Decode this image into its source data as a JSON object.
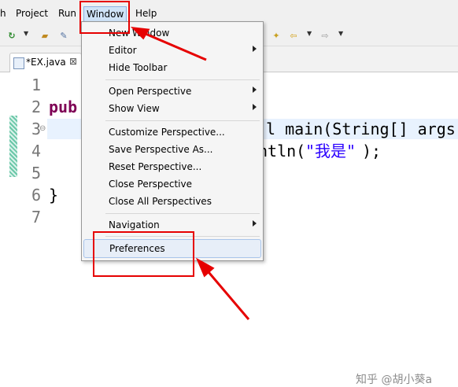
{
  "menubar": {
    "items": [
      "h",
      "Project",
      "Run",
      "Window",
      "Help"
    ],
    "active": "Window"
  },
  "editor_tab": {
    "title": "*EX.java",
    "close_glyph": "⊠"
  },
  "editor": {
    "line_numbers": [
      "1",
      "2",
      "3",
      "4",
      "5",
      "6",
      "7"
    ],
    "lines": {
      "line2": "pub",
      "line3": "l main(String[] args",
      "line4_pre": "ntln(",
      "line4_str": "\"我是\"",
      "line4_post": ");",
      "line6": "}"
    }
  },
  "window_menu": {
    "items": [
      {
        "label": "New Window",
        "submenu": false
      },
      {
        "label": "Editor",
        "submenu": true
      },
      {
        "label": "Hide Toolbar",
        "submenu": false
      },
      {
        "label": "Open Perspective",
        "submenu": true
      },
      {
        "label": "Show View",
        "submenu": true
      },
      {
        "label": "Customize Perspective...",
        "submenu": false
      },
      {
        "label": "Save Perspective As...",
        "submenu": false
      },
      {
        "label": "Reset Perspective...",
        "submenu": false
      },
      {
        "label": "Close Perspective",
        "submenu": false
      },
      {
        "label": "Close All Perspectives",
        "submenu": false
      },
      {
        "label": "Navigation",
        "submenu": true
      },
      {
        "label": "Preferences",
        "submenu": false
      }
    ],
    "hovered": "Preferences"
  },
  "watermark": "知乎 @胡小葵a",
  "colors": {
    "annotation": "#e60000",
    "keyword": "#7f0055",
    "string": "#2a00ff",
    "menu_hover": "#e7eef8"
  }
}
